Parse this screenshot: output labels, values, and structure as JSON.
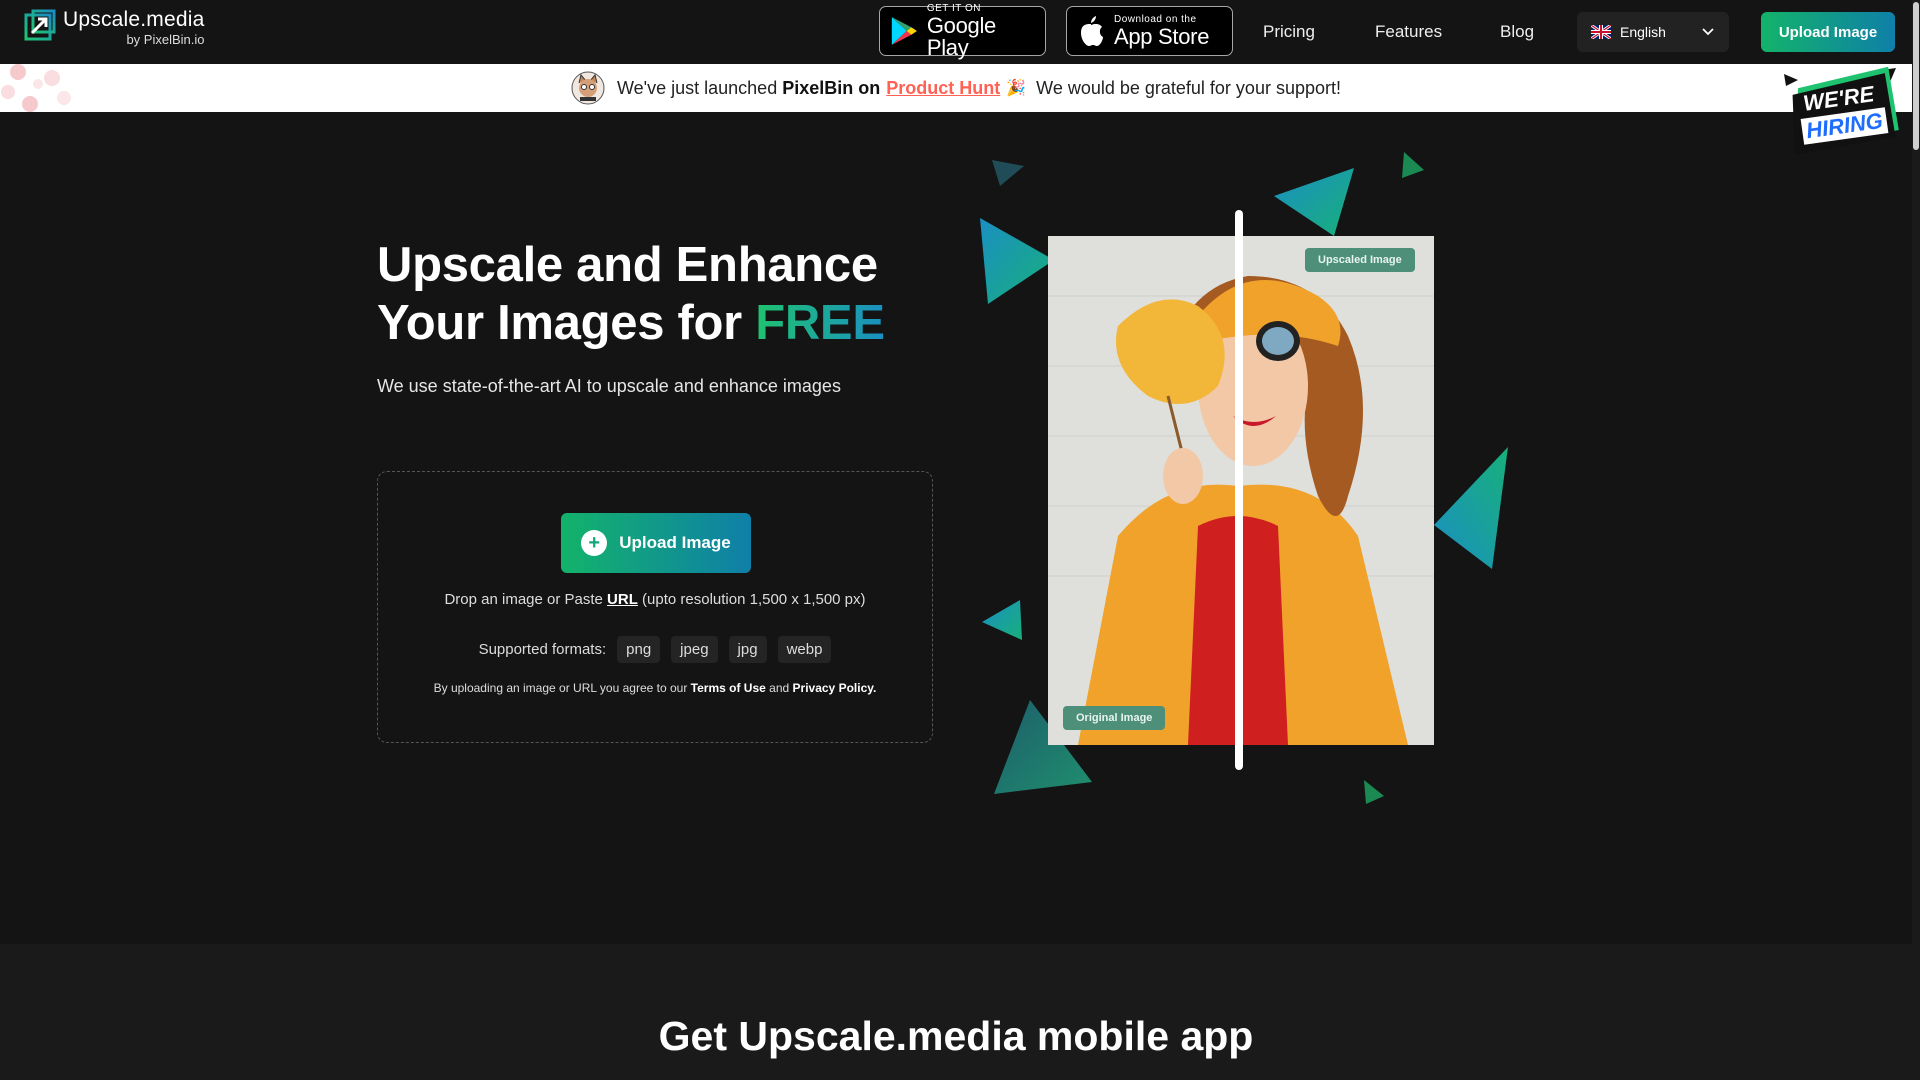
{
  "header": {
    "logo_name": "Upscale.media",
    "logo_by": "by PixelBin.io",
    "google_play": {
      "small": "GET IT ON",
      "big": "Google Play"
    },
    "app_store": {
      "small": "Download on the",
      "big": "App Store"
    },
    "nav": {
      "pricing": "Pricing",
      "features": "Features",
      "blog": "Blog"
    },
    "language": "English",
    "upload_label": "Upload Image"
  },
  "banner": {
    "prefix": "We've just launched",
    "brand": "PixelBin on",
    "product_hunt": "Product Hunt",
    "suffix": "We would be grateful for your support!",
    "hiring_line1": "WE'RE",
    "hiring_line2": "HIRING"
  },
  "hero": {
    "title_line1": "Upscale and Enhance",
    "title_line2": "Your Images for",
    "title_highlight": "FREE",
    "subtitle": "We use state-of-the-art AI to upscale and enhance images"
  },
  "dropzone": {
    "upload_label": "Upload Image",
    "drop_text": "Drop an image or Paste",
    "url_label": "URL",
    "resolution_text": "(upto resolution 1,500 x 1,500 px)",
    "formats_label": "Supported formats:",
    "formats": [
      "png",
      "jpeg",
      "jpg",
      "webp"
    ],
    "terms_prefix": "By uploading an image or URL you agree to our",
    "terms_link": "Terms of Use",
    "terms_and": "and",
    "privacy_link": "Privacy Policy."
  },
  "compare": {
    "upscaled_label": "Upscaled Image",
    "original_label": "Original Image"
  },
  "bottom": {
    "title": "Get Upscale.media mobile app"
  },
  "colors": {
    "accent_green": "#13b36a",
    "accent_blue": "#0f7fa8",
    "product_hunt": "#ff6154",
    "background": "#141414"
  }
}
